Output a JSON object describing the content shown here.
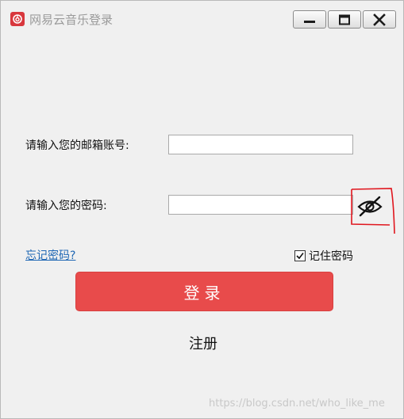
{
  "window": {
    "title": "网易云音乐登录",
    "controls": [
      "minimize-icon",
      "maximize-icon",
      "close-icon"
    ]
  },
  "form": {
    "email_label": "请输入您的邮箱账号:",
    "email_value": "",
    "password_label": "请输入您的密码:",
    "password_value": "",
    "toggle_visibility_icon": "eye-slash-icon",
    "forgot_link": "忘记密码?",
    "remember_label": "记住密码",
    "remember_checked": true,
    "login_label": "登录",
    "register_label": "注册"
  },
  "watermark": "https://blog.csdn.net/who_like_me",
  "colors": {
    "login_button": "#e84b4b",
    "link": "#1f67b4",
    "annotation": "#e0161e",
    "logo": "#d8373d"
  }
}
